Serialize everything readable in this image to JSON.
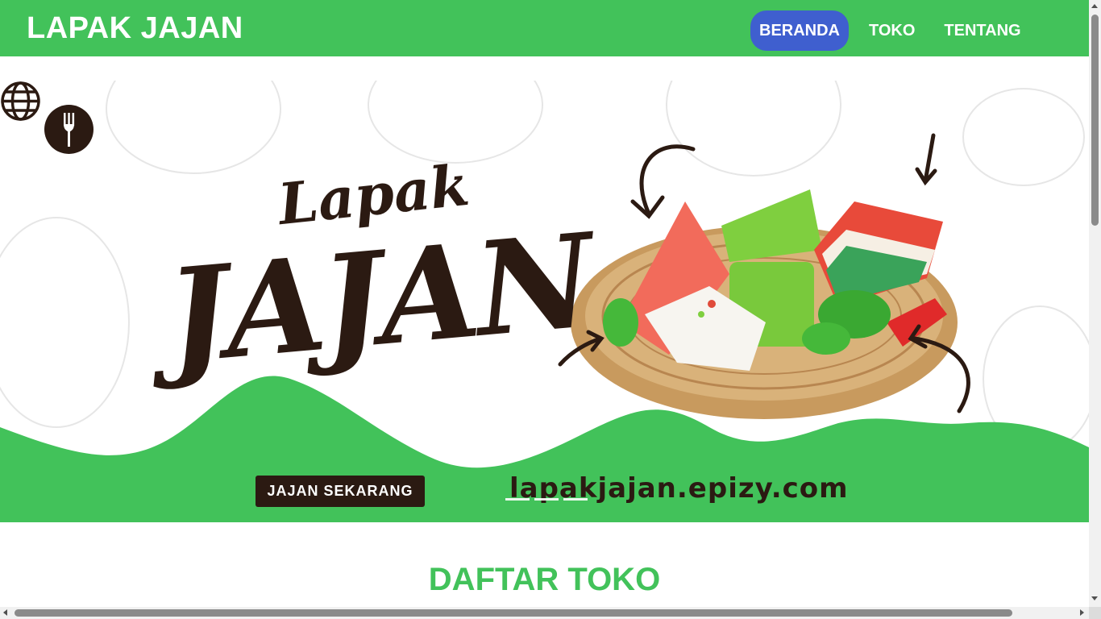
{
  "navbar": {
    "brand": "LAPAK JAJAN",
    "links": [
      {
        "label": "BERANDA",
        "active": true
      },
      {
        "label": "TOKO",
        "active": false
      },
      {
        "label": "TENTANG",
        "active": false
      }
    ]
  },
  "banner": {
    "title_small": "Lapak",
    "title_big": "JAJAN",
    "cta_label": "JAJAN SEKARANG",
    "website": "lapakjajan.epizy.com",
    "carousel_slides": 3,
    "carousel_active_index": 0
  },
  "main": {
    "section_title": "DAFTAR TOKO"
  },
  "colors": {
    "brand_green": "#42c25a",
    "active_nav_blue": "#3f5fcf",
    "dark_brown": "#2b1a12"
  }
}
